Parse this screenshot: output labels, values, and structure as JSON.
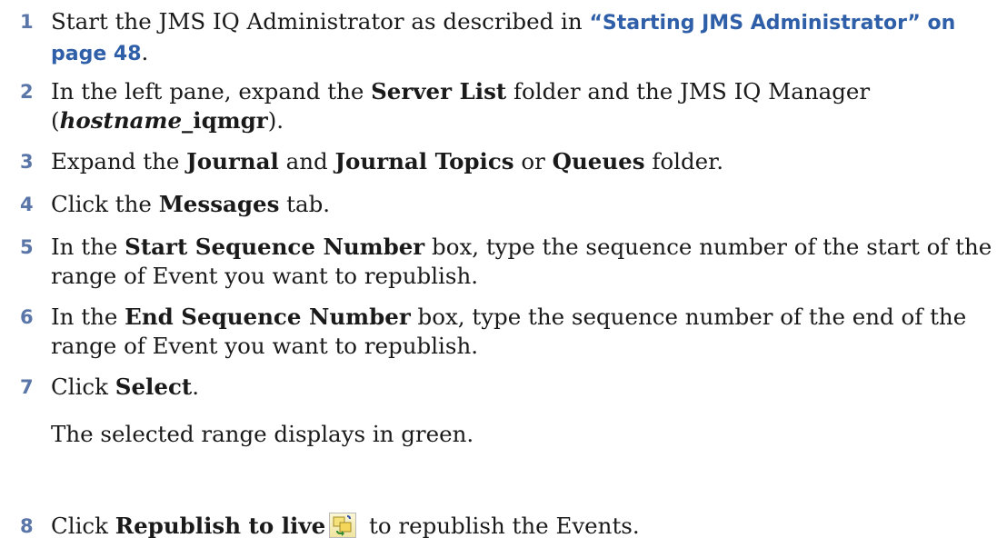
{
  "steps": [
    {
      "num": "1",
      "t1": "Start the JMS IQ Administrator as described in ",
      "link": "“Starting JMS Administrator” on page 48",
      "t2": "."
    },
    {
      "num": "2",
      "t1": "In the left pane, expand the ",
      "b1": "Server List",
      "t2": " folder and the JMS IQ Manager (",
      "i1": "hostname",
      "b2": "_iqmgr",
      "t3": ")."
    },
    {
      "num": "3",
      "t1": "Expand the ",
      "b1": "Journal",
      "t2": " and ",
      "b2": "Journal Topics",
      "t3": " or ",
      "b3": "Queues",
      "t4": " folder."
    },
    {
      "num": "4",
      "t1": "Click the ",
      "b1": "Messages",
      "t2": " tab."
    },
    {
      "num": "5",
      "t1": "In the ",
      "b1": "Start Sequence Number",
      "t2": " box, type the sequence number of the start of the range of Event you want to republish."
    },
    {
      "num": "6",
      "t1": "In the ",
      "b1": "End Sequence Number",
      "t2": " box, type the sequence number of the end of the range of Event you want to republish."
    },
    {
      "num": "7",
      "t1": "Click ",
      "b1": "Select",
      "t2": "."
    },
    {
      "num": "8",
      "t1": "Click ",
      "b1": "Republish to live",
      "t2": " to republish the Events."
    }
  ],
  "note": "The selected range displays in green.",
  "icons": {
    "republish": "republish-to-live-icon"
  }
}
